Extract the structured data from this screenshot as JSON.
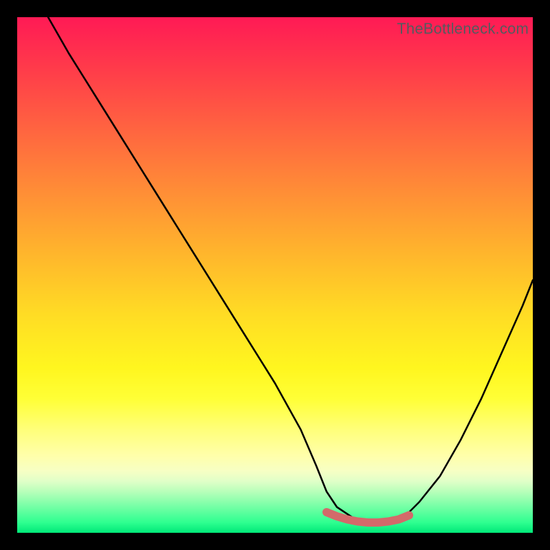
{
  "watermark": "TheBottleneck.com",
  "chart_data": {
    "type": "line",
    "title": "",
    "xlabel": "",
    "ylabel": "",
    "xlim": [
      0,
      100
    ],
    "ylim": [
      0,
      100
    ],
    "grid": false,
    "series": [
      {
        "name": "bottleneck-curve",
        "color": "#000000",
        "x": [
          6,
          10,
          15,
          20,
          25,
          30,
          35,
          40,
          45,
          50,
          55,
          58,
          60,
          62,
          65,
          68,
          72,
          75,
          78,
          82,
          86,
          90,
          94,
          98,
          100
        ],
        "y": [
          100,
          93,
          85,
          77,
          69,
          61,
          53,
          45,
          37,
          29,
          20,
          13,
          8,
          5,
          3,
          2,
          2,
          3,
          6,
          11,
          18,
          26,
          35,
          44,
          49
        ]
      },
      {
        "name": "optimal-range-marker",
        "color": "#d36a6a",
        "x": [
          60,
          62,
          64,
          66,
          68,
          70,
          72,
          74,
          76
        ],
        "y": [
          4.0,
          3.2,
          2.6,
          2.2,
          2.0,
          2.0,
          2.2,
          2.6,
          3.4
        ]
      }
    ],
    "gradient_meaning": "vertical performance score (red=high bottleneck, green=optimal)"
  }
}
